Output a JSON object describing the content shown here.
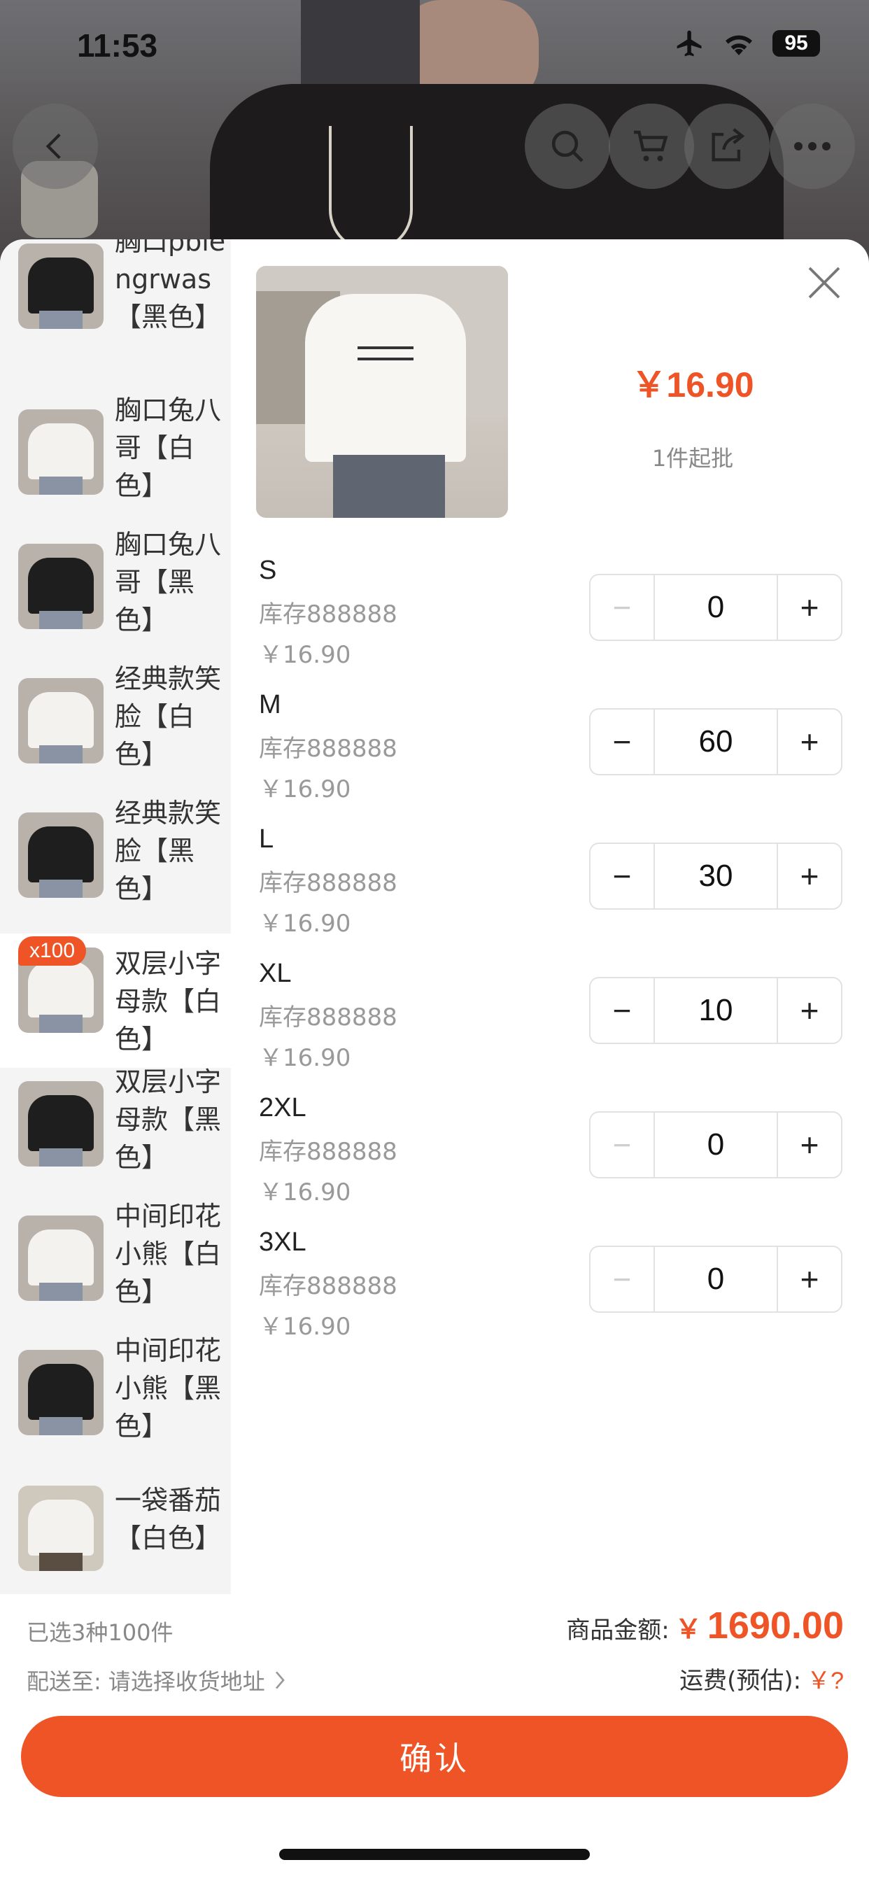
{
  "status_bar": {
    "time": "11:53",
    "battery": "95"
  },
  "nav": {
    "back_icon": "chevron-left-icon",
    "search_icon": "search-icon",
    "cart_icon": "cart-icon",
    "share_icon": "share-icon",
    "more_icon": "more-icon"
  },
  "variants": [
    {
      "label": "胸口pblengrwas【黑色】",
      "tee_color": "#1e1e1e",
      "badge": ""
    },
    {
      "label": "胸口兔八哥【白色】",
      "tee_color": "#f3f2ef",
      "badge": ""
    },
    {
      "label": "胸口兔八哥【黑色】",
      "tee_color": "#1e1e1e",
      "badge": ""
    },
    {
      "label": "经典款笑脸【白色】",
      "tee_color": "#f3f2ef",
      "badge": ""
    },
    {
      "label": "经典款笑脸【黑色】",
      "tee_color": "#1e1e1e",
      "badge": ""
    },
    {
      "label": "双层小字母款【白色】",
      "tee_color": "#f3f2ef",
      "badge": "x100",
      "active": true
    },
    {
      "label": "双层小字母款【黑色】",
      "tee_color": "#1e1e1e",
      "badge": ""
    },
    {
      "label": "中间印花小熊【白色】",
      "tee_color": "#f3f2ef",
      "badge": ""
    },
    {
      "label": "中间印花小熊【黑色】",
      "tee_color": "#1e1e1e",
      "badge": ""
    },
    {
      "label": "一袋番茄【白色】",
      "tee_color": "#f3f2ef",
      "badge": ""
    }
  ],
  "product": {
    "price": "￥16.90",
    "min_order": "1件起批",
    "close_icon": "close-icon"
  },
  "sizes": [
    {
      "name": "S",
      "stock": "库存888888",
      "price": "￥16.90",
      "qty": "0"
    },
    {
      "name": "M",
      "stock": "库存888888",
      "price": "￥16.90",
      "qty": "60"
    },
    {
      "name": "L",
      "stock": "库存888888",
      "price": "￥16.90",
      "qty": "30"
    },
    {
      "name": "XL",
      "stock": "库存888888",
      "price": "￥16.90",
      "qty": "10"
    },
    {
      "name": "2XL",
      "stock": "库存888888",
      "price": "￥16.90",
      "qty": "0"
    },
    {
      "name": "3XL",
      "stock": "库存888888",
      "price": "￥16.90",
      "qty": "0"
    }
  ],
  "stepper": {
    "minus": "−",
    "plus": "+"
  },
  "summary": {
    "selected": "已选3种100件",
    "ship_label": "配送至:",
    "ship_link": "请选择收货地址",
    "total_label": "商品金额:",
    "total_currency": "￥",
    "total_amount": "1690.00",
    "freight_label": "运费(预估):",
    "freight_value": "￥?"
  },
  "confirm_label": "确认",
  "colors": {
    "accent": "#ee5426"
  }
}
